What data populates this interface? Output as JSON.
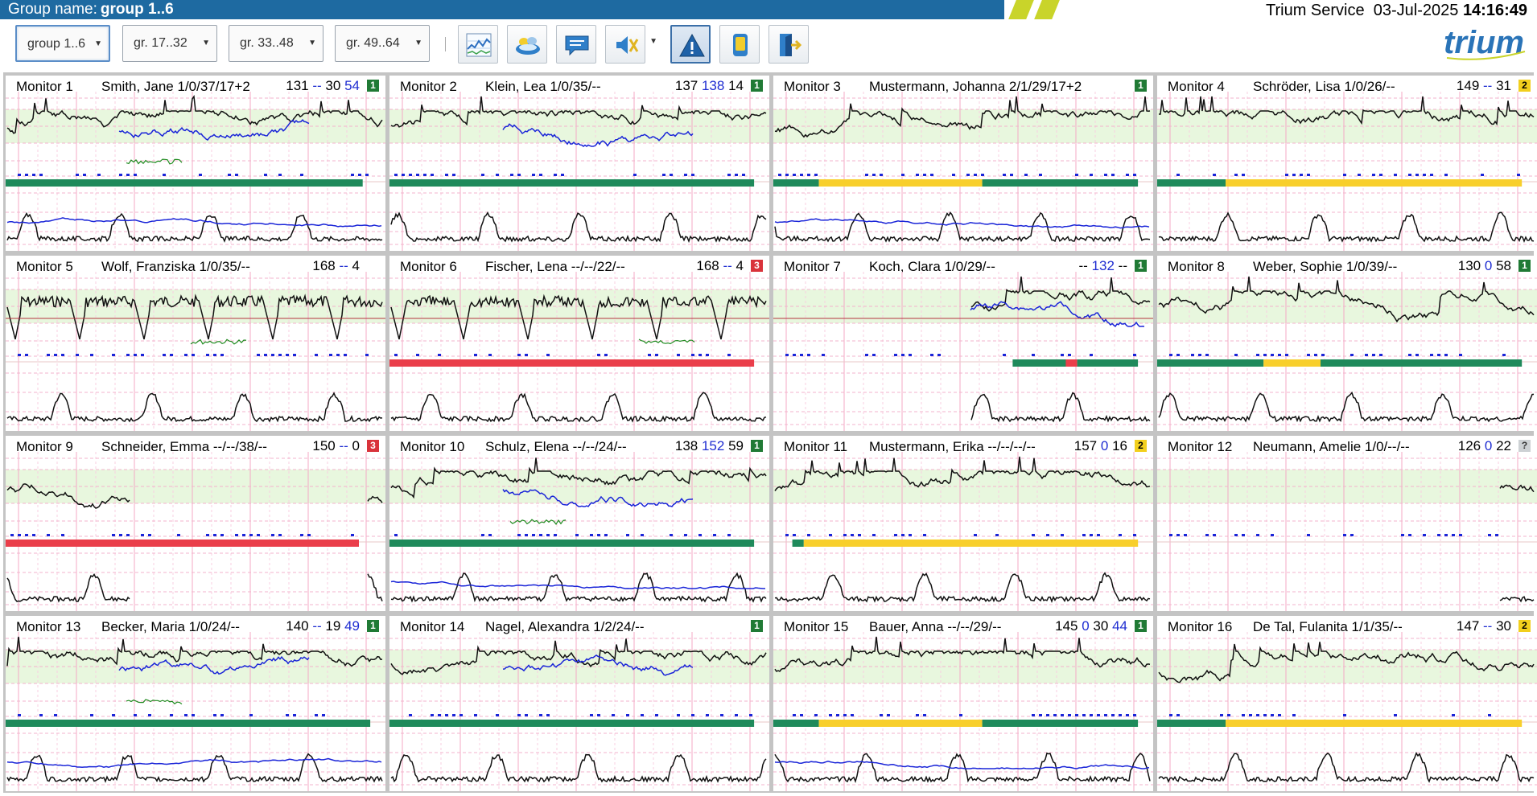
{
  "header": {
    "group_label": "Group name:",
    "group_name": "group 1..6",
    "service_name": "Trium Service",
    "date": "03-Jul-2025",
    "time": "14:16:49",
    "logo_text": "trium"
  },
  "toolbar": {
    "group_selects": [
      {
        "label": "group 1..6",
        "active": true
      },
      {
        "label": "gr. 17..32",
        "active": false
      },
      {
        "label": "gr. 33..48",
        "active": false
      },
      {
        "label": "gr. 49..64",
        "active": false
      }
    ],
    "buttons": [
      {
        "icon": "trend-chart-icon"
      },
      {
        "icon": "monitor-overview-icon"
      },
      {
        "icon": "chat-message-icon"
      },
      {
        "icon": "mute-alarm-icon"
      },
      {
        "icon": "warning-icon"
      },
      {
        "icon": "device-icon"
      },
      {
        "icon": "logout-icon"
      }
    ]
  },
  "colors": {
    "brand_blue": "#1e6aa1",
    "stripe_yellow": "#c9d42a",
    "status_green": "#1f8a5b",
    "status_yellow": "#f8cf2c",
    "status_red": "#ea3e4a",
    "grid_pink": "#f4a9c6",
    "normal_band_green": "#e8f7de",
    "trace_black": "#111111",
    "trace_blue": "#1a25d8",
    "trace_green": "#1f8a1f"
  },
  "monitors": [
    {
      "name": "Monitor 1",
      "patient": "Smith, Jane 1/0/37/17+2",
      "v1": "131",
      "v2": "--",
      "v3": "30",
      "v4": "54",
      "badge": "1",
      "badge_color": "green",
      "status_segments": [
        {
          "color": "green",
          "from": 0,
          "to": 0.94
        }
      ],
      "flat": [],
      "blue_overlay": true,
      "green_trace": true,
      "red_line": false,
      "bottom_blue": true
    },
    {
      "name": "Monitor 2",
      "patient": "Klein, Lea 1/0/35/--",
      "v1": "137",
      "v2": "138",
      "v3": "14",
      "v4": "",
      "badge": "1",
      "badge_color": "green",
      "status_segments": [
        {
          "color": "green",
          "from": 0,
          "to": 0.96
        }
      ],
      "flat": [],
      "blue_overlay": true,
      "green_trace": false,
      "red_line": false,
      "bottom_blue": false
    },
    {
      "name": "Monitor 3",
      "patient": "Mustermann, Johanna 2/1/29/17+2",
      "v1": "",
      "v2": "",
      "v3": "",
      "v4": "",
      "badge": "1",
      "badge_color": "green",
      "status_segments": [
        {
          "color": "green",
          "from": 0,
          "to": 0.12
        },
        {
          "color": "yellow",
          "from": 0.12,
          "to": 0.55
        },
        {
          "color": "green",
          "from": 0.55,
          "to": 0.96
        }
      ],
      "flat": [],
      "blue_overlay": false,
      "green_trace": false,
      "red_line": false,
      "bottom_blue": true
    },
    {
      "name": "Monitor 4",
      "patient": "Schröder, Lisa 1/0/26/--",
      "v1": "149",
      "v2": "--",
      "v3": "31",
      "v4": "",
      "badge": "2",
      "badge_color": "yellow",
      "status_segments": [
        {
          "color": "green",
          "from": 0,
          "to": 0.18
        },
        {
          "color": "yellow",
          "from": 0.18,
          "to": 0.96
        }
      ],
      "flat": [],
      "blue_overlay": false,
      "green_trace": false,
      "red_line": false,
      "bottom_blue": false
    },
    {
      "name": "Monitor 5",
      "patient": "Wolf, Franziska 1/0/35/--",
      "v1": "168",
      "v2": "--",
      "v3": "4",
      "v4": "",
      "badge": "",
      "badge_color": "",
      "status_segments": [],
      "flat": [],
      "blue_overlay": false,
      "green_trace": true,
      "red_line": true,
      "bottom_blue": false
    },
    {
      "name": "Monitor 6",
      "patient": "Fischer, Lena --/--/22/--",
      "v1": "168",
      "v2": "--",
      "v3": "4",
      "v4": "",
      "badge": "3",
      "badge_color": "red",
      "status_segments": [
        {
          "color": "red",
          "from": 0,
          "to": 0.96
        }
      ],
      "flat": [],
      "blue_overlay": false,
      "green_trace": true,
      "red_line": true,
      "bottom_blue": false
    },
    {
      "name": "Monitor 7",
      "patient": "Koch, Clara 1/0/29/--",
      "v1": "--",
      "v2": "132",
      "v3": "--",
      "v4": "",
      "badge": "1",
      "badge_color": "green",
      "status_segments": [
        {
          "color": "green",
          "from": 0.63,
          "to": 0.77
        },
        {
          "color": "red",
          "from": 0.77,
          "to": 0.8
        },
        {
          "color": "green",
          "from": 0.8,
          "to": 0.96
        }
      ],
      "flat": [
        [
          0,
          0.52
        ]
      ],
      "blue_overlay": true,
      "green_trace": false,
      "red_line": true,
      "bottom_blue": false
    },
    {
      "name": "Monitor 8",
      "patient": "Weber, Sophie 1/0/39/--",
      "v1": "130",
      "v2": "0",
      "v3": "58",
      "v4": "",
      "badge": "1",
      "badge_color": "green",
      "status_segments": [
        {
          "color": "green",
          "from": 0,
          "to": 0.28
        },
        {
          "color": "yellow",
          "from": 0.28,
          "to": 0.43
        },
        {
          "color": "green",
          "from": 0.43,
          "to": 0.96
        }
      ],
      "flat": [],
      "blue_overlay": false,
      "green_trace": false,
      "red_line": false,
      "bottom_blue": false
    },
    {
      "name": "Monitor 9",
      "patient": "Schneider, Emma --/--/38/--",
      "v1": "150",
      "v2": "--",
      "v3": "0",
      "v4": "",
      "badge": "3",
      "badge_color": "red",
      "status_segments": [
        {
          "color": "red",
          "from": 0,
          "to": 0.93
        }
      ],
      "flat": [
        [
          0.33,
          0.95
        ]
      ],
      "blue_overlay": false,
      "green_trace": false,
      "red_line": false,
      "bottom_blue": false
    },
    {
      "name": "Monitor 10",
      "patient": "Schulz, Elena --/--/24/--",
      "v1": "138",
      "v2": "152",
      "v3": "59",
      "v4": "",
      "badge": "1",
      "badge_color": "green",
      "status_segments": [
        {
          "color": "green",
          "from": 0,
          "to": 0.96
        }
      ],
      "flat": [],
      "blue_overlay": true,
      "green_trace": true,
      "red_line": false,
      "bottom_blue": true
    },
    {
      "name": "Monitor 11",
      "patient": "Mustermann, Erika --/--/--/--",
      "v1": "157",
      "v2": "0",
      "v3": "16",
      "v4": "",
      "badge": "2",
      "badge_color": "yellow",
      "status_segments": [
        {
          "color": "green",
          "from": 0.05,
          "to": 0.08
        },
        {
          "color": "yellow",
          "from": 0.08,
          "to": 0.96
        }
      ],
      "flat": [],
      "blue_overlay": false,
      "green_trace": false,
      "red_line": false,
      "bottom_blue": false
    },
    {
      "name": "Monitor 12",
      "patient": "Neumann, Amelie 1/0/--/--",
      "v1": "126",
      "v2": "0",
      "v3": "22",
      "v4": "",
      "badge": "?",
      "badge_color": "gray",
      "status_segments": [],
      "flat": [
        [
          0,
          0.9
        ]
      ],
      "blue_overlay": false,
      "green_trace": false,
      "red_line": false,
      "bottom_blue": false
    },
    {
      "name": "Monitor 13",
      "patient": "Becker, Maria 1/0/24/--",
      "v1": "140",
      "v2": "--",
      "v3": "19",
      "v4": "49",
      "badge": "1",
      "badge_color": "green",
      "status_segments": [
        {
          "color": "green",
          "from": 0,
          "to": 0.96
        }
      ],
      "flat": [],
      "blue_overlay": true,
      "green_trace": true,
      "red_line": false,
      "bottom_blue": true
    },
    {
      "name": "Monitor 14",
      "patient": "Nagel, Alexandra 1/2/24/--",
      "v1": "",
      "v2": "",
      "v3": "",
      "v4": "",
      "badge": "1",
      "badge_color": "green",
      "status_segments": [
        {
          "color": "green",
          "from": 0,
          "to": 0.96
        }
      ],
      "flat": [],
      "blue_overlay": true,
      "green_trace": false,
      "red_line": false,
      "bottom_blue": false
    },
    {
      "name": "Monitor 15",
      "patient": "Bauer, Anna --/--/29/--",
      "v1": "145",
      "v2": "0",
      "v3": "30",
      "v4": "44",
      "badge": "1",
      "badge_color": "green",
      "status_segments": [
        {
          "color": "green",
          "from": 0,
          "to": 0.12
        },
        {
          "color": "yellow",
          "from": 0.12,
          "to": 0.55
        },
        {
          "color": "green",
          "from": 0.55,
          "to": 0.96
        }
      ],
      "flat": [],
      "blue_overlay": false,
      "green_trace": false,
      "red_line": false,
      "bottom_blue": true
    },
    {
      "name": "Monitor 16",
      "patient": "De Tal, Fulanita 1/1/35/--",
      "v1": "147",
      "v2": "--",
      "v3": "30",
      "v4": "",
      "badge": "2",
      "badge_color": "yellow",
      "status_segments": [
        {
          "color": "green",
          "from": 0,
          "to": 0.18
        },
        {
          "color": "yellow",
          "from": 0.18,
          "to": 0.96
        }
      ],
      "flat": [],
      "blue_overlay": false,
      "green_trace": false,
      "red_line": false,
      "bottom_blue": false
    }
  ]
}
